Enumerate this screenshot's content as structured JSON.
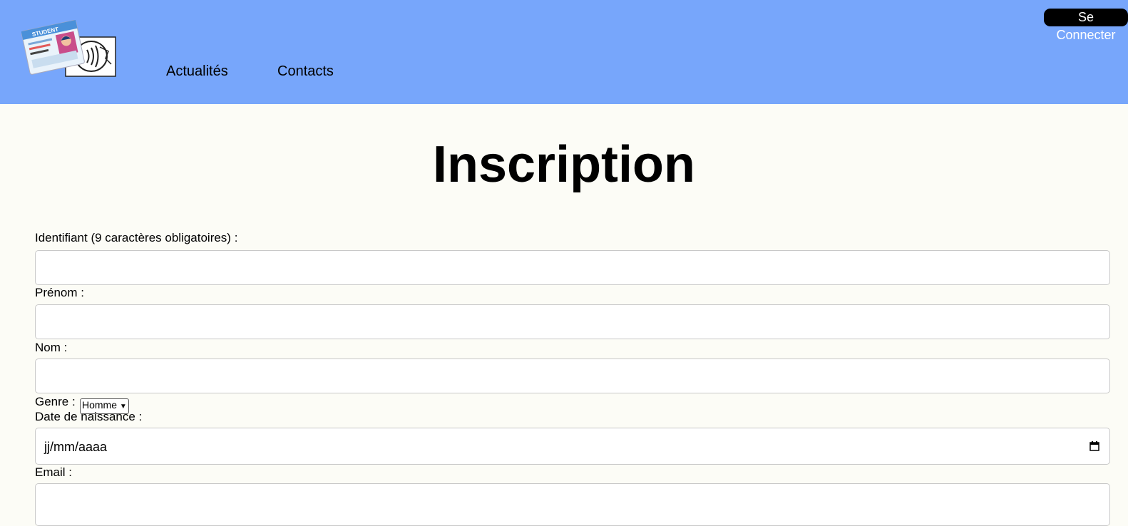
{
  "header": {
    "logo_text": "STUDENT",
    "nav": [
      {
        "label": "Actualités"
      },
      {
        "label": "Contacts"
      }
    ],
    "login_label": "Se Connecter"
  },
  "page": {
    "title": "Inscription"
  },
  "form": {
    "identifiant": {
      "label": "Identifiant (9 caractères obligatoires) :",
      "value": ""
    },
    "prenom": {
      "label": "Prénom :",
      "value": ""
    },
    "nom": {
      "label": "Nom :",
      "value": ""
    },
    "genre": {
      "label": "Genre :",
      "selected": "Homme"
    },
    "naissance": {
      "label": "Date de naissance :",
      "placeholder": "jj/mm/aaaa"
    },
    "email": {
      "label": "Email :",
      "value": ""
    }
  },
  "colors": {
    "header_bg": "#77a6fb",
    "page_bg": "#fcfcf6",
    "button_bg": "#000000"
  }
}
